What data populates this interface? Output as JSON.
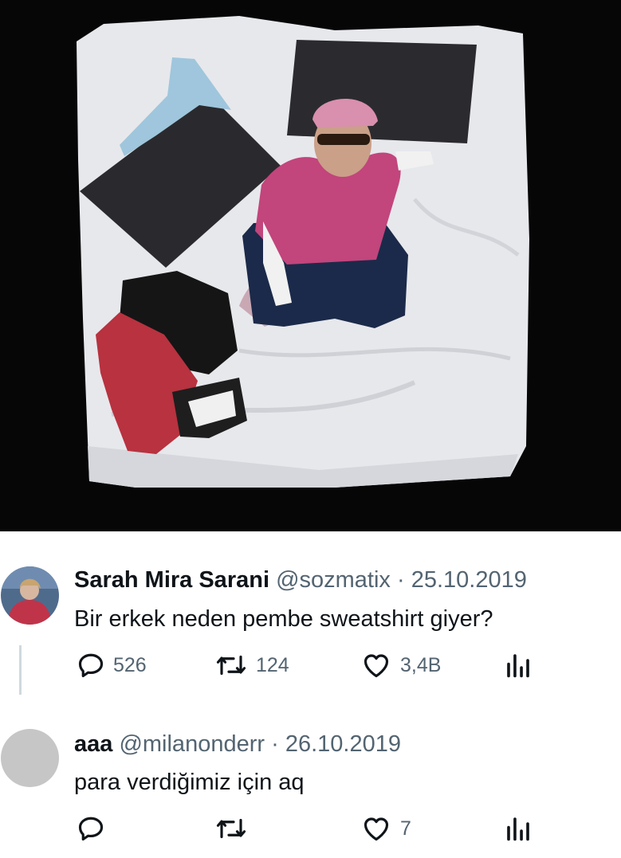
{
  "photo": {
    "description_icon": "bed-photo"
  },
  "tweets": [
    {
      "name": "Sarah Mira Sarani",
      "handle": "@sozmatix",
      "separator": "·",
      "date": "25.10.2019",
      "text": "Bir erkek neden pembe sweatshirt giyer?",
      "replies": "526",
      "retweets": "124",
      "likes": "3,4B"
    },
    {
      "name": "aaa",
      "handle": "@milanonderr",
      "separator": "·",
      "date": "26.10.2019",
      "text": "para verdiğimiz için aq",
      "replies": "",
      "retweets": "",
      "likes": "7"
    }
  ],
  "colors": {
    "text": "#0f1419",
    "secondary": "#536471",
    "thread_line": "#cfd9de",
    "avatar_placeholder": "#c6c6c6"
  }
}
